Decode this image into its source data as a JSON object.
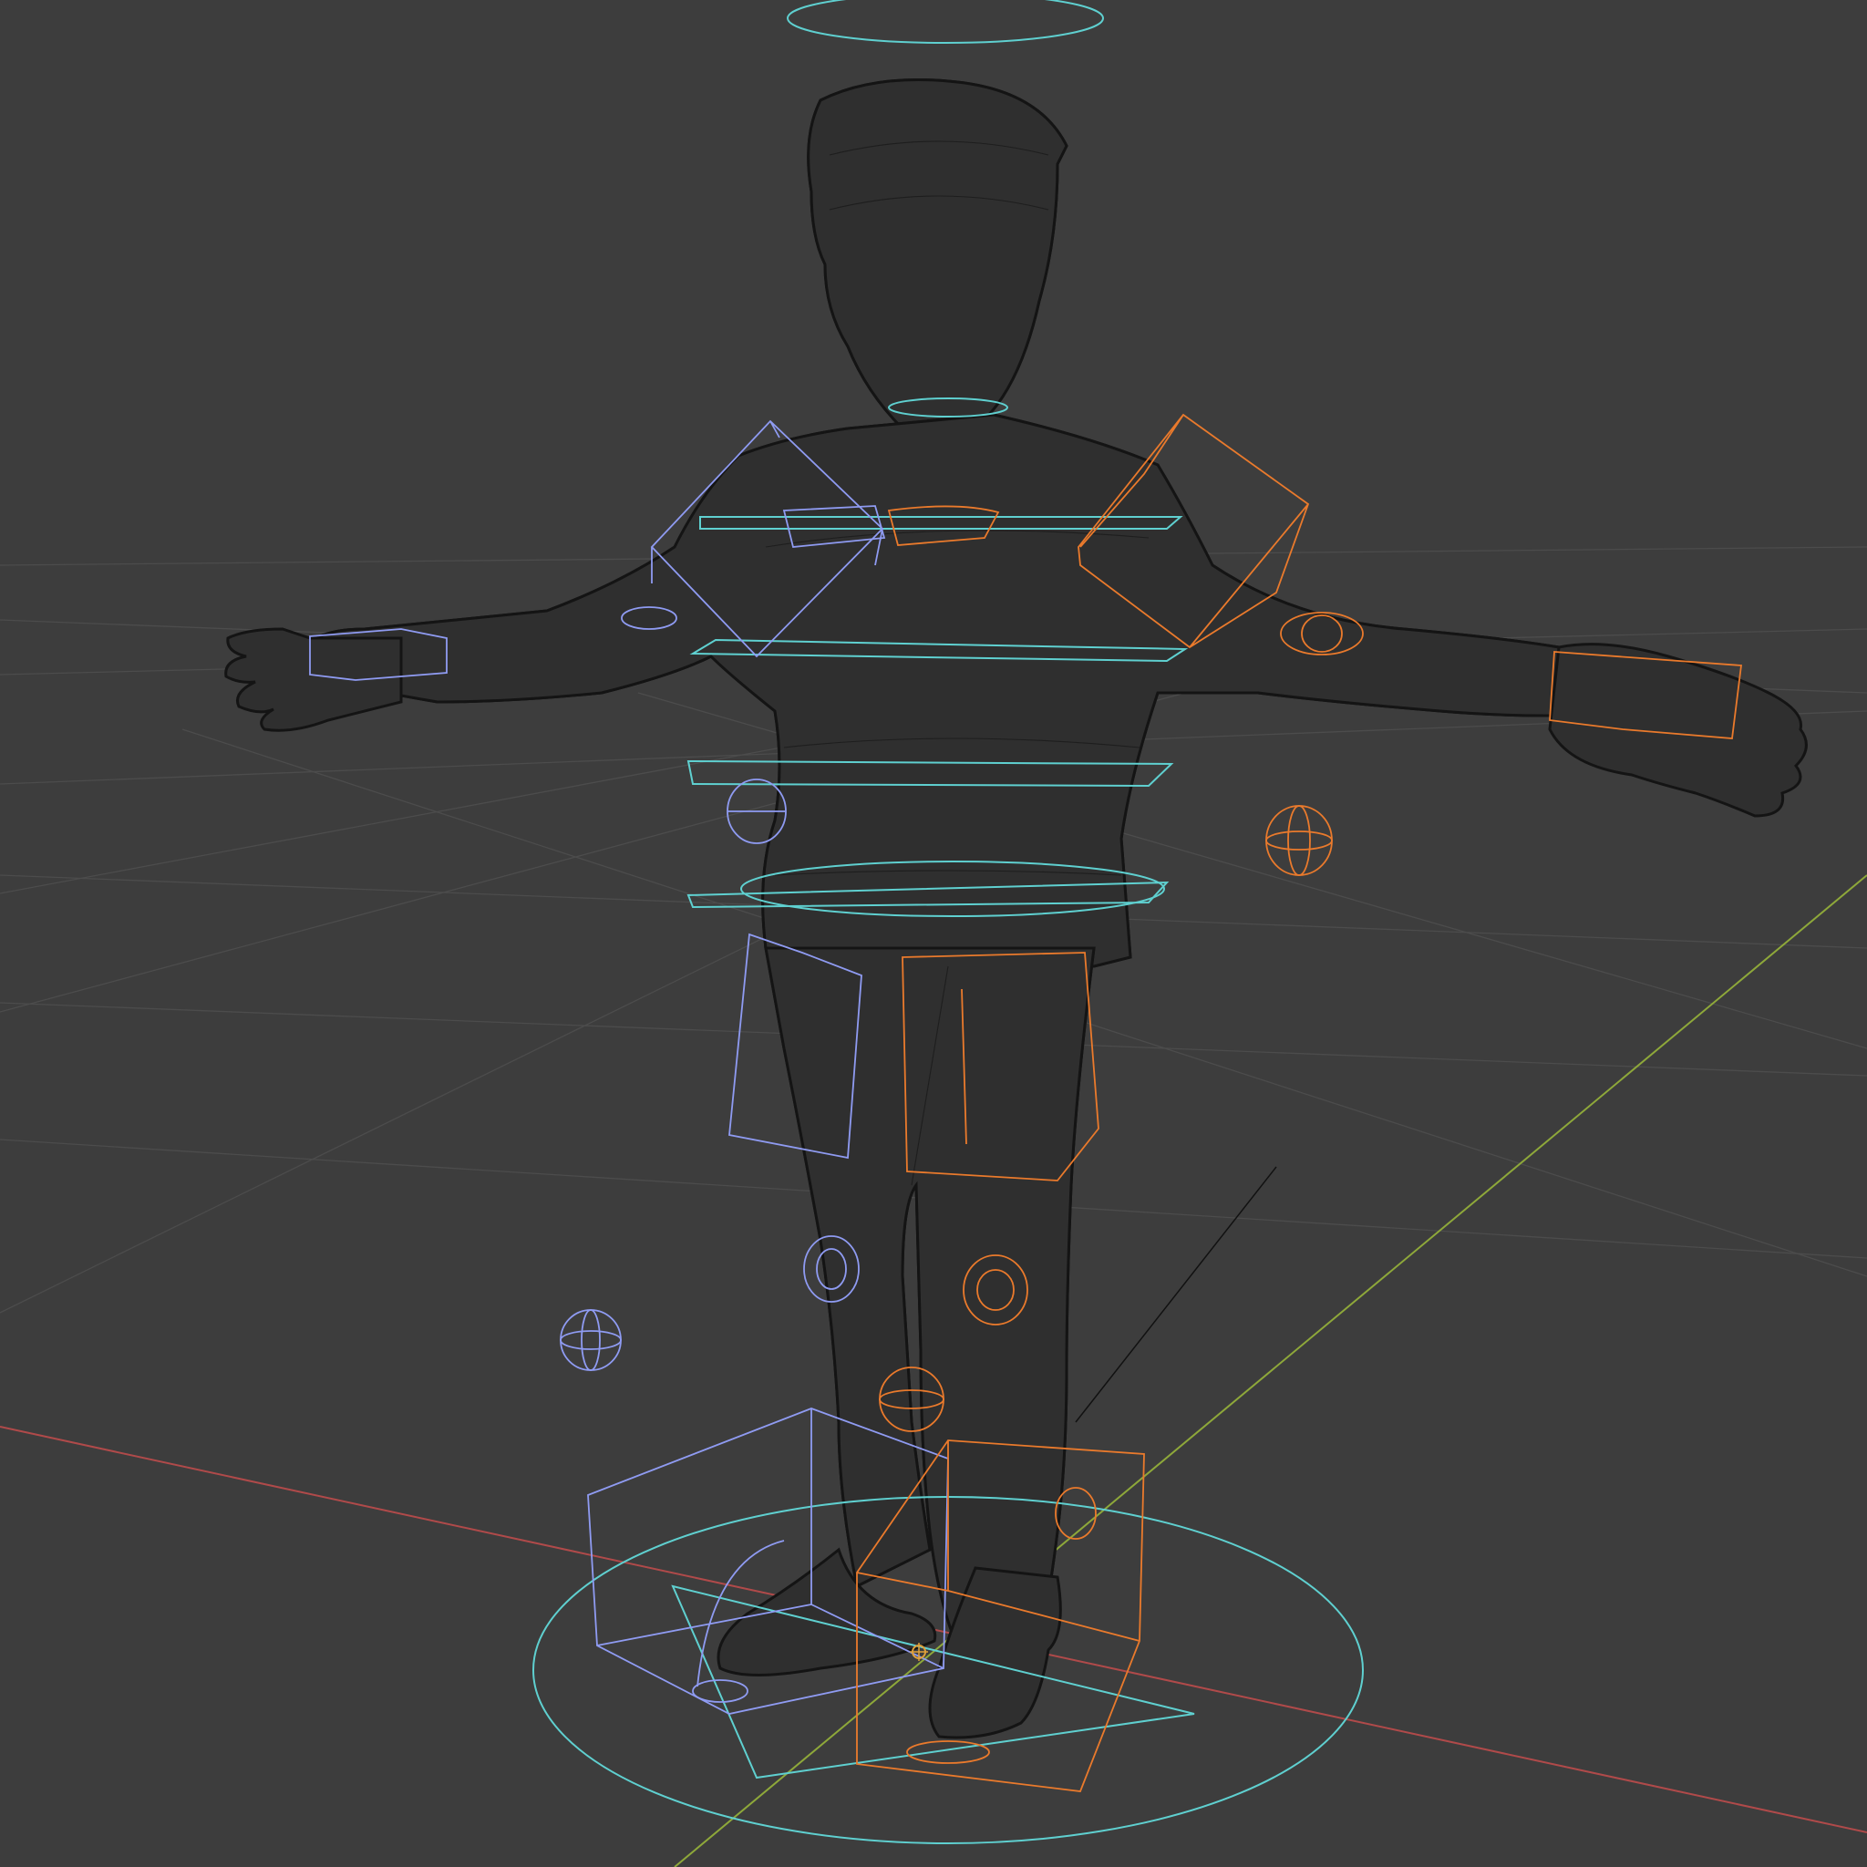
{
  "viewport": {
    "shading": "wireframe",
    "background": "#3d3d3d",
    "grid_color": "#4c4c4c",
    "axis_x_color": "#b04a4a",
    "axis_y_color": "#8ea83a",
    "mesh_wire_color": "#1b1b1b"
  },
  "rig": {
    "center_controls_color": "#5fd0d0",
    "left_controls_color": "#8f9bf2",
    "right_controls_color": "#ea7a2c",
    "icons": [
      "origin-icon"
    ]
  }
}
